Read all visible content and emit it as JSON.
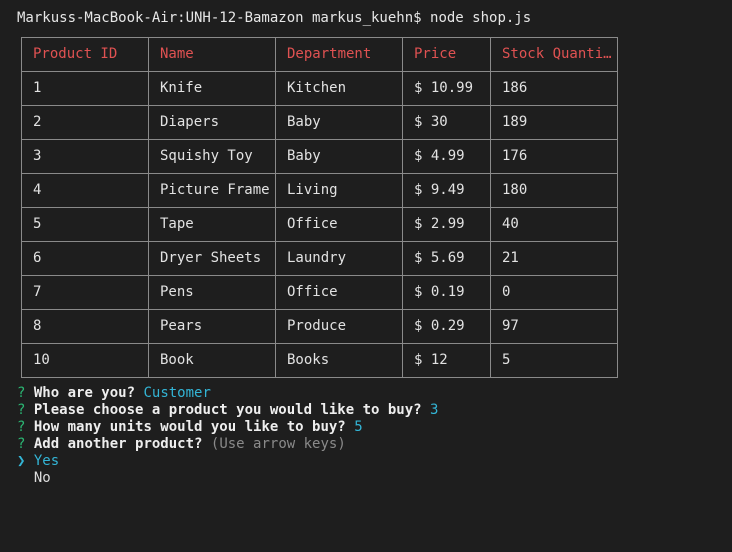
{
  "terminal": {
    "prompt": "Markuss-MacBook-Air:UNH-12-Bamazon markus_kuehn$",
    "command": "node shop.js"
  },
  "table": {
    "headers": [
      "Product ID",
      "Name",
      "Department",
      "Price",
      "Stock Quanti…"
    ],
    "rows": [
      [
        "1",
        "Knife",
        "Kitchen",
        "$ 10.99",
        "186"
      ],
      [
        "2",
        "Diapers",
        "Baby",
        "$ 30",
        "189"
      ],
      [
        "3",
        "Squishy Toy",
        "Baby",
        "$ 4.99",
        "176"
      ],
      [
        "4",
        "Picture Frame",
        "Living",
        "$ 9.49",
        "180"
      ],
      [
        "5",
        "Tape",
        "Office",
        "$ 2.99",
        "40"
      ],
      [
        "6",
        "Dryer Sheets",
        "Laundry",
        "$ 5.69",
        "21"
      ],
      [
        "7",
        "Pens",
        "Office",
        "$ 0.19",
        "0"
      ],
      [
        "8",
        "Pears",
        "Produce",
        "$ 0.29",
        "97"
      ],
      [
        "10",
        "Book",
        "Books",
        "$ 12",
        "5"
      ]
    ]
  },
  "prompts": [
    {
      "mark": "?",
      "question": "Who are you?",
      "answer": "Customer",
      "hint": ""
    },
    {
      "mark": "?",
      "question": "Please choose a product you would like to buy?",
      "answer": "3",
      "hint": ""
    },
    {
      "mark": "?",
      "question": "How many units would you like to buy?",
      "answer": "5",
      "hint": ""
    },
    {
      "mark": "?",
      "question": "Add another product?",
      "answer": "",
      "hint": "(Use arrow keys)"
    }
  ],
  "choices": {
    "pointer": "❯",
    "options": [
      "Yes",
      "No"
    ],
    "selected_index": 0
  },
  "colors": {
    "background": "#1e1e1e",
    "header_text": "#e05252",
    "question_mark": "#2bb673",
    "answer": "#33b5d6",
    "hint": "#8a8a8a",
    "border": "#8a8a8a"
  }
}
